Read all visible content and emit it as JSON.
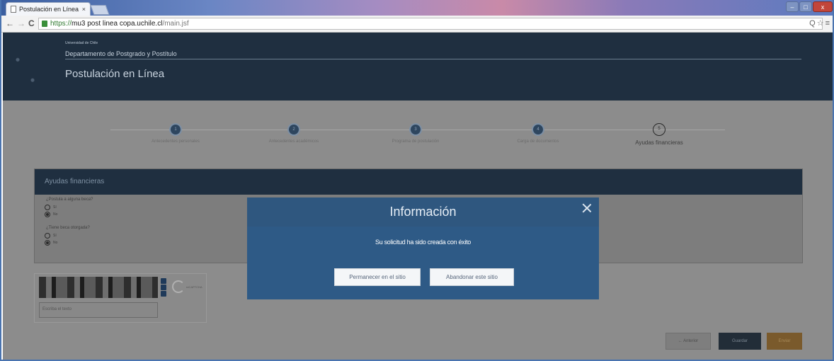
{
  "browser": {
    "tab_title": "Postulación en Línea",
    "tab_close": "×",
    "nav_back": "←",
    "nav_forward": "→",
    "nav_reload": "C",
    "url_scheme": "https://",
    "url_host": "mu3 post linea copa.uchile.cl",
    "url_path": "/main.jsf",
    "toolbar_icons": "Q☆≡",
    "window_controls": {
      "minimize": "–",
      "maximize": "□",
      "close": "x"
    }
  },
  "banner": {
    "university": "Universidad de Chile",
    "department": "Departamento de Postgrado y Postítulo",
    "title": "Postulación en Línea"
  },
  "steps": [
    {
      "number": "1",
      "label": "Antecedentes personales"
    },
    {
      "number": "2",
      "label": "Antecedentes académicos"
    },
    {
      "number": "3",
      "label": "Programa de postulación"
    },
    {
      "number": "4",
      "label": "Carga de documentos"
    },
    {
      "number": "5",
      "label": "Ayudas financieras",
      "current": true
    }
  ],
  "section": {
    "title": "Ayudas financieras",
    "q1": {
      "label": "¿Postula a alguna beca?",
      "option_yes": "Sí",
      "option_no": "No",
      "selected": "No"
    },
    "q2": {
      "label": "¿Tiene beca otorgada?",
      "option_yes": "Sí",
      "option_no": "No",
      "selected": "No"
    }
  },
  "captcha": {
    "provider_label": "reCAPTCHA",
    "input_placeholder": "Escriba el texto"
  },
  "actions": {
    "back": "Anterior",
    "save": "Guardar",
    "next": "Enviar"
  },
  "modal": {
    "title": "Información",
    "message": "Su solicitud ha sido creada con éxito",
    "stay": "Permanecer en el sitio",
    "leave": "Abandonar este sitio"
  }
}
